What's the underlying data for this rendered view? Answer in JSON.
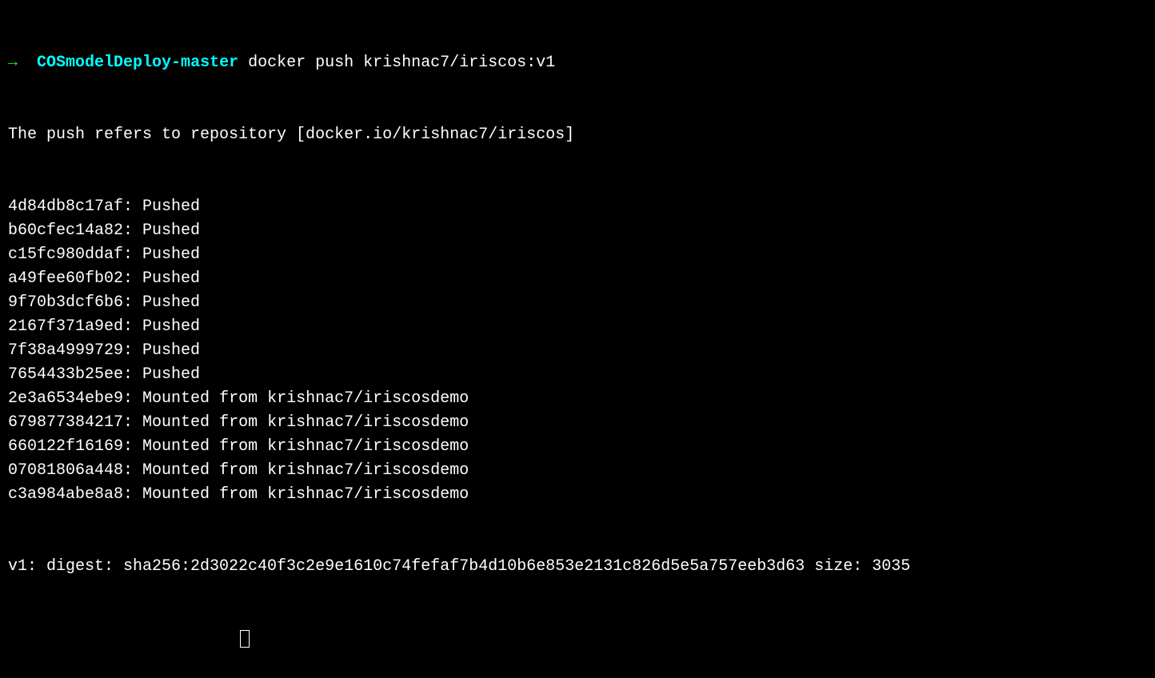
{
  "prompt": {
    "arrow": "→",
    "directory": "COSmodelDeploy-master",
    "command": "docker push krishnac7/iriscos:v1"
  },
  "repoLine": "The push refers to repository [docker.io/krishnac7/iriscos]",
  "layers": [
    {
      "hash": "4d84db8c17af",
      "status": "Pushed"
    },
    {
      "hash": "b60cfec14a82",
      "status": "Pushed"
    },
    {
      "hash": "c15fc980ddaf",
      "status": "Pushed"
    },
    {
      "hash": "a49fee60fb02",
      "status": "Pushed"
    },
    {
      "hash": "9f70b3dcf6b6",
      "status": "Pushed"
    },
    {
      "hash": "2167f371a9ed",
      "status": "Pushed"
    },
    {
      "hash": "7f38a4999729",
      "status": "Pushed"
    },
    {
      "hash": "7654433b25ee",
      "status": "Pushed"
    },
    {
      "hash": "2e3a6534ebe9",
      "status": "Mounted from krishnac7/iriscosdemo"
    },
    {
      "hash": "679877384217",
      "status": "Mounted from krishnac7/iriscosdemo"
    },
    {
      "hash": "660122f16169",
      "status": "Mounted from krishnac7/iriscosdemo"
    },
    {
      "hash": "07081806a448",
      "status": "Mounted from krishnac7/iriscosdemo"
    },
    {
      "hash": "c3a984abe8a8",
      "status": "Mounted from krishnac7/iriscosdemo"
    }
  ],
  "digestLine": "v1: digest: sha256:2d3022c40f3c2e9e1610c74fefaf7b4d10b6e853e2131c826d5e5a757eeb3d63 size: 3035"
}
